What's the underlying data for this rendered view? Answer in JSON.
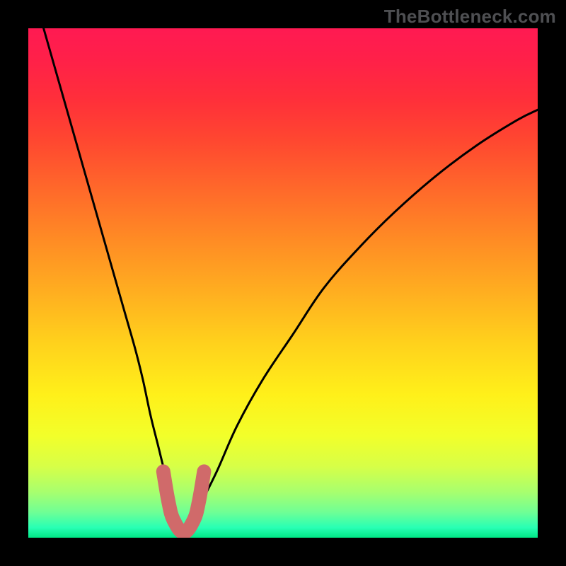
{
  "attribution": "TheBottleneck.com",
  "colors": {
    "gradient_stops": [
      {
        "offset": 0.0,
        "color": "#ff1a52"
      },
      {
        "offset": 0.06,
        "color": "#ff2049"
      },
      {
        "offset": 0.14,
        "color": "#ff2f3a"
      },
      {
        "offset": 0.22,
        "color": "#ff4730"
      },
      {
        "offset": 0.32,
        "color": "#ff6a2a"
      },
      {
        "offset": 0.42,
        "color": "#ff8d24"
      },
      {
        "offset": 0.52,
        "color": "#ffaf20"
      },
      {
        "offset": 0.62,
        "color": "#ffd21c"
      },
      {
        "offset": 0.72,
        "color": "#fff01a"
      },
      {
        "offset": 0.8,
        "color": "#f2ff2a"
      },
      {
        "offset": 0.86,
        "color": "#d7ff47"
      },
      {
        "offset": 0.91,
        "color": "#a8ff6e"
      },
      {
        "offset": 0.95,
        "color": "#6fff95"
      },
      {
        "offset": 0.98,
        "color": "#28ffb4"
      },
      {
        "offset": 1.0,
        "color": "#00e886"
      }
    ],
    "curve": "#000000",
    "highlight": "#d06a6a"
  },
  "chart_data": {
    "type": "line",
    "title": "",
    "xlabel": "",
    "ylabel": "",
    "xlim": [
      0,
      100
    ],
    "ylim": [
      0,
      100
    ],
    "grid": false,
    "legend": false,
    "series": [
      {
        "name": "bottleneck-curve",
        "x": [
          3,
          5,
          7,
          9,
          11,
          13,
          15,
          17,
          19,
          21,
          22.5,
          24,
          25.5,
          27,
          29,
          30.5,
          32,
          34,
          37,
          41,
          46,
          52,
          58,
          65,
          72,
          80,
          88,
          96,
          100
        ],
        "values": [
          100,
          93,
          86,
          79,
          72,
          65,
          58,
          51,
          44,
          37,
          31,
          24,
          18,
          12,
          5,
          2,
          3,
          7,
          13,
          22,
          31,
          40,
          49,
          57,
          64,
          71,
          77,
          82,
          84
        ]
      }
    ],
    "annotations": [
      {
        "name": "minimum-highlight",
        "x_range": [
          26.5,
          34.5
        ],
        "y_range": [
          1,
          13
        ],
        "note": "thick salmon U-shaped marker at curve minimum"
      }
    ]
  }
}
